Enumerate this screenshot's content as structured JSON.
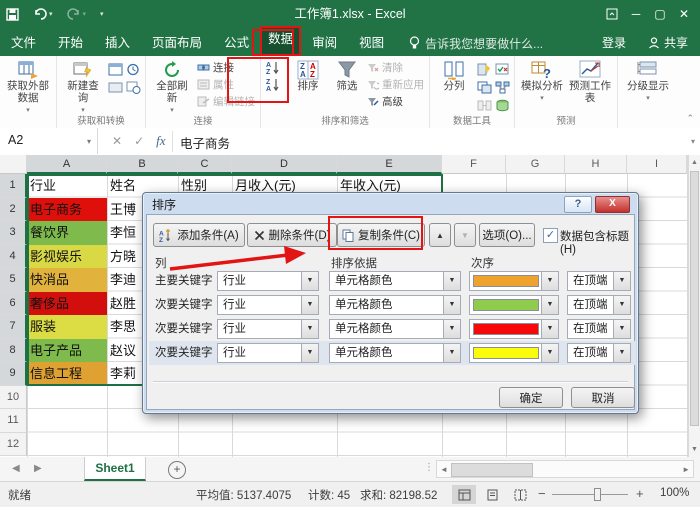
{
  "titlebar": {
    "title": "工作簿1.xlsx - Excel"
  },
  "tabs": {
    "file": "文件",
    "items": [
      "开始",
      "插入",
      "页面布局",
      "公式",
      "数据",
      "审阅",
      "视图"
    ],
    "selected": "数据",
    "tell_me": "告诉我您想要做什么...",
    "sign_in": "登录",
    "share": "共享"
  },
  "ribbon": {
    "get_external": "获取外部数据",
    "new_query": "新建查询",
    "refresh_all": "全部刷新",
    "connections": "连接",
    "properties": "属性",
    "edit_links": "编辑链接",
    "sort": "排序",
    "filter": "筛选",
    "clear": "清除",
    "reapply": "重新应用",
    "advanced": "高级",
    "text_to_columns": "分列",
    "what_if": "模拟分析",
    "forecast_sheet": "预测工作表",
    "outline": "分级显示",
    "group_labels": {
      "get_transform": "获取和转换",
      "connections": "连接",
      "sort_filter": "排序和筛选",
      "data_tools": "数据工具",
      "forecast": "预测"
    }
  },
  "formula_bar": {
    "name_box": "A2",
    "value": "电子商务"
  },
  "grid": {
    "col_headers": [
      "A",
      "B",
      "C",
      "D",
      "E",
      "F",
      "G",
      "H",
      "I"
    ],
    "rows": [
      {
        "n": "1",
        "cells": {
          "A": "行业",
          "B": "姓名",
          "C": "性别",
          "D": "月收入(元)",
          "E": "年收入(元)"
        }
      },
      {
        "n": "2",
        "cells": {
          "A": "电子商务",
          "B": "王博"
        },
        "a_color": "#DF100C"
      },
      {
        "n": "3",
        "cells": {
          "A": "餐饮界",
          "B": "李恒"
        },
        "a_color": "#7EBB4C"
      },
      {
        "n": "4",
        "cells": {
          "A": "影视娱乐",
          "B": "方晓"
        },
        "a_color": "#D9D945"
      },
      {
        "n": "5",
        "cells": {
          "A": "快消品",
          "B": "李迪"
        },
        "a_color": "#E2B33C"
      },
      {
        "n": "6",
        "cells": {
          "A": "奢侈品",
          "B": "赵胜"
        },
        "a_color": "#D20F0C"
      },
      {
        "n": "7",
        "cells": {
          "A": "服装",
          "B": "李思"
        },
        "a_color": "#DCDC45"
      },
      {
        "n": "8",
        "cells": {
          "A": "电子产品",
          "B": "赵议"
        },
        "a_color": "#7EBB4C"
      },
      {
        "n": "9",
        "cells": {
          "A": "信息工程",
          "B": "李莉"
        },
        "a_color": "#DFA232"
      },
      {
        "n": "10"
      },
      {
        "n": "11"
      },
      {
        "n": "12"
      }
    ]
  },
  "dialog": {
    "title": "排序",
    "help": "?",
    "close": "X",
    "toolbar": {
      "add": "添加条件(A)",
      "del": "删除条件(D)",
      "copy": "复制条件(C)",
      "options": "选项(O)...",
      "header_check": "数据包含标题(H)",
      "checked": "✓"
    },
    "headers": {
      "column": "列",
      "sort_on": "排序依据",
      "order": "次序"
    },
    "criteria": [
      {
        "level": "主要关键字",
        "column": "行业",
        "sort_on": "单元格颜色",
        "color": "#EFA22E",
        "order": "在顶端"
      },
      {
        "level": "次要关键字",
        "column": "行业",
        "sort_on": "单元格颜色",
        "color": "#8FCB4D",
        "order": "在顶端"
      },
      {
        "level": "次要关键字",
        "column": "行业",
        "sort_on": "单元格颜色",
        "color": "#F70909",
        "order": "在顶端"
      },
      {
        "level": "次要关键字",
        "column": "行业",
        "sort_on": "单元格颜色",
        "color": "#FBFB0C",
        "order": "在顶端"
      }
    ],
    "ok": "确定",
    "cancel": "取消"
  },
  "sheet_bar": {
    "sheet": "Sheet1"
  },
  "status_bar": {
    "ready": "就绪",
    "average": "平均值: 5137.4075",
    "count": "计数: 45",
    "sum": "求和: 82198.52",
    "zoom": "100%"
  },
  "colors": {
    "excel_green": "#217346",
    "annotation_red": "#E21414"
  }
}
